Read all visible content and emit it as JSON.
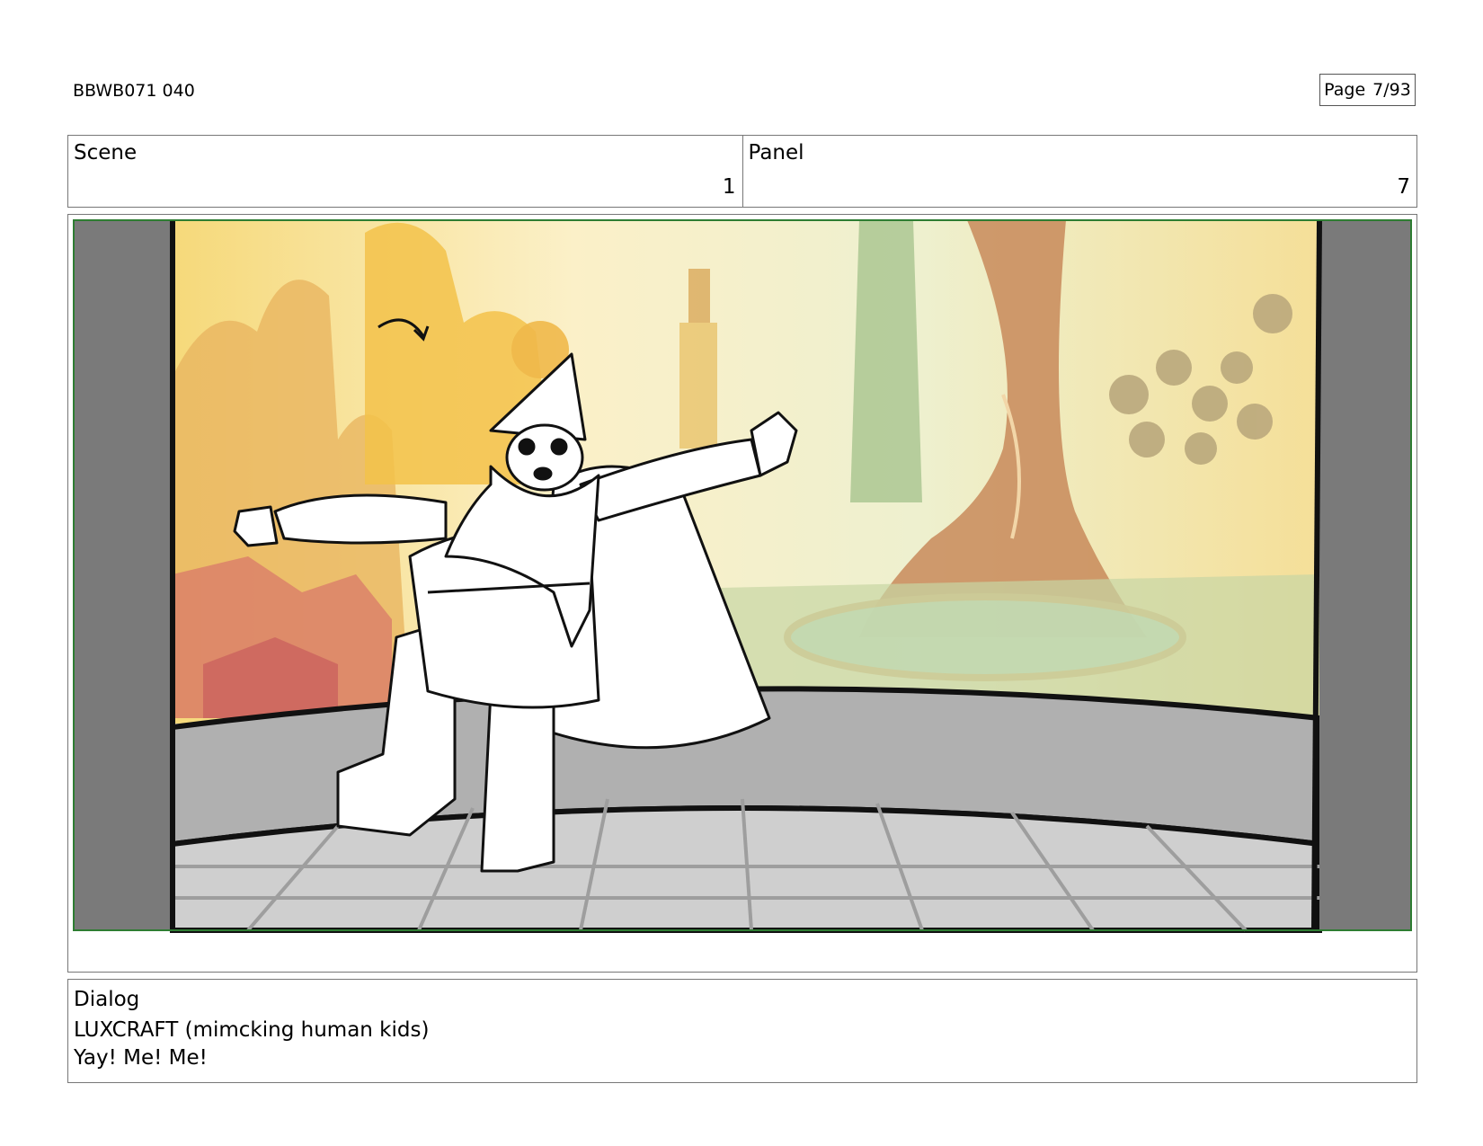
{
  "header": {
    "doc_id": "BBWB071 040",
    "page_label": "Page",
    "page_value": "7/93"
  },
  "panel_info": {
    "scene_label": "Scene",
    "scene_number": "1",
    "panel_label": "Panel",
    "panel_number": "7"
  },
  "dialog": {
    "label": "Dialog",
    "speaker": "LUXCRAFT (mimcking human kids)",
    "line": "Yay! Me! Me!"
  },
  "colors": {
    "safe_area_border": "#2e7d32",
    "letterbox": "#7a7a7a",
    "stage_wall": "#b0b0b0",
    "stage_floor": "#cfcfcf"
  }
}
